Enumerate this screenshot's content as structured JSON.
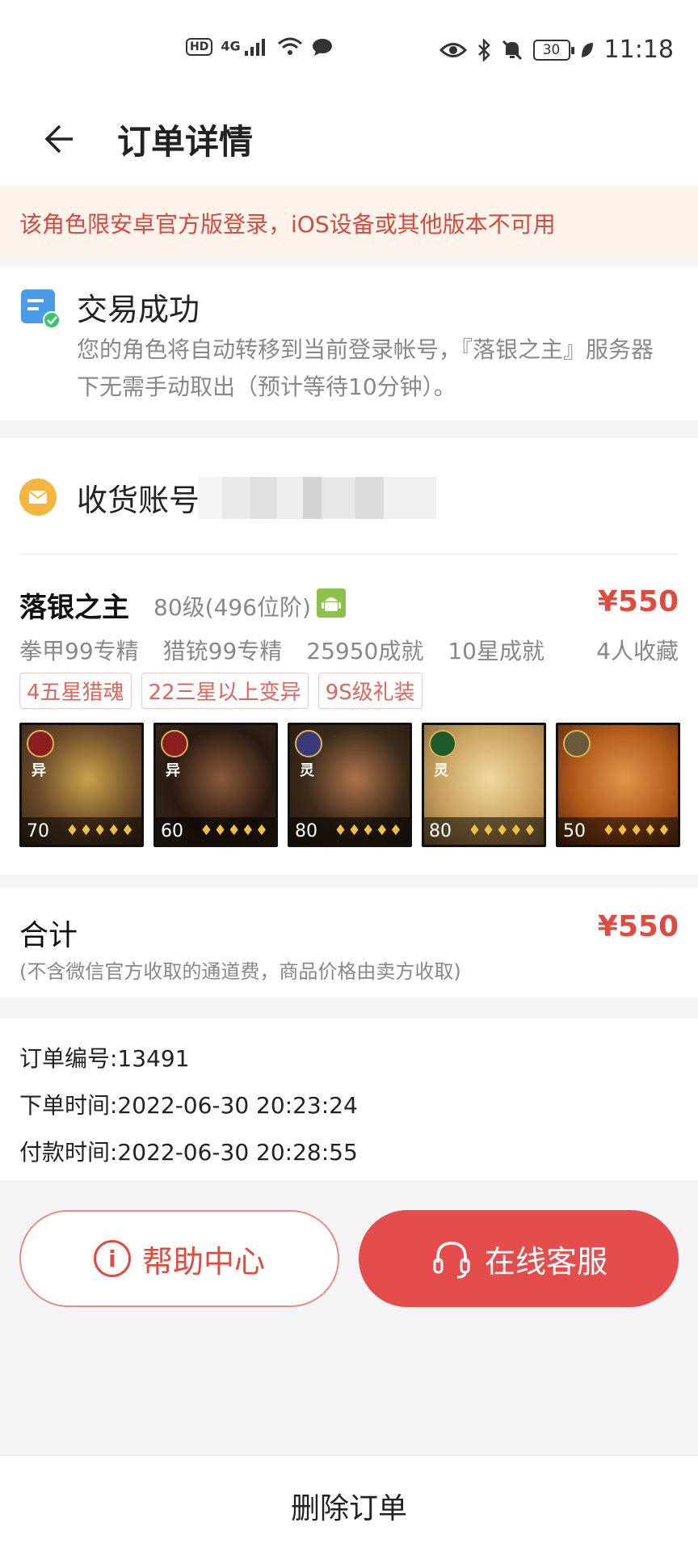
{
  "status_bar": {
    "hd": "HD",
    "signal": "4G",
    "battery": "30",
    "time": "11:18"
  },
  "header": {
    "title": "订单详情"
  },
  "notice": {
    "text": "该角色限安卓官方版登录，iOS设备或其他版本不可用"
  },
  "status_card": {
    "title": "交易成功",
    "description": "您的角色将自动转移到当前登录帐号，『落银之主』服务器下无需手动取出（预计等待10分钟）。"
  },
  "account": {
    "label": "收货账号"
  },
  "product": {
    "name": "落银之主",
    "level": "80级(496位阶)",
    "price": "¥550",
    "stats": [
      "拳甲99专精",
      "猎铳99专精",
      "25950成就",
      "10星成就"
    ],
    "favorites": "4人收藏",
    "tags": [
      "4五星猎魂",
      "22三星以上变异",
      "9S级礼装"
    ],
    "heroes": [
      {
        "level": "70",
        "type": "异",
        "badge_color": "#8b1e1e",
        "art": [
          "#6b4a2a",
          "#c9a24a",
          "#3a2818"
        ]
      },
      {
        "level": "60",
        "type": "异",
        "badge_color": "#8b1e1e",
        "art": [
          "#2a1a12",
          "#8a5a3a",
          "#3a2a1a"
        ]
      },
      {
        "level": "80",
        "type": "灵",
        "badge_color": "#3a3a7a",
        "art": [
          "#3a2a1a",
          "#b0744a",
          "#2a1a10"
        ]
      },
      {
        "level": "80",
        "type": "灵",
        "badge_color": "#1e5a2a",
        "art": [
          "#c9a060",
          "#f0d8a0",
          "#8a6a3a"
        ]
      },
      {
        "level": "50",
        "type": "",
        "badge_color": "#6a5a3a",
        "art": [
          "#b05a1a",
          "#e0944a",
          "#5a2a10"
        ]
      }
    ]
  },
  "total": {
    "label": "合计",
    "note": "(不含微信官方收取的通道费，商品价格由卖方收取)",
    "price": "¥550"
  },
  "order_info": {
    "order_no": "订单编号:13491",
    "order_time": "下单时间:2022-06-30 20:23:24",
    "pay_time": "付款时间:2022-06-30 20:28:55"
  },
  "buttons": {
    "help": "帮助中心",
    "service": "在线客服",
    "delete": "删除订单"
  },
  "colors": {
    "accent": "#e54c4c",
    "price": "#e04b40",
    "notice_bg": "#fdf3ea"
  }
}
